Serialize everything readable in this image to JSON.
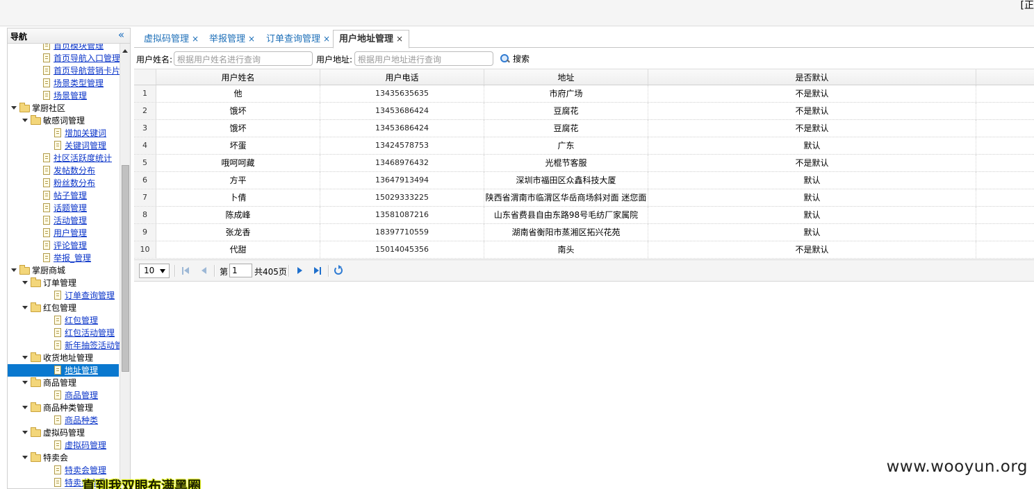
{
  "header": {
    "corner_text": "[正"
  },
  "nav": {
    "title": "导航",
    "tree": [
      {
        "label": "首页模块管理",
        "type": "file",
        "level": 2,
        "link": true
      },
      {
        "label": "首页导航入口管理",
        "type": "file",
        "level": 2,
        "link": true
      },
      {
        "label": "首页导航营销卡片管",
        "type": "file",
        "level": 2,
        "link": true
      },
      {
        "label": "场景类型管理",
        "type": "file",
        "level": 2,
        "link": true
      },
      {
        "label": "场景管理",
        "type": "file",
        "level": 2,
        "link": true
      },
      {
        "label": "掌厨社区",
        "type": "folder",
        "level": 1
      },
      {
        "label": "敏感词管理",
        "type": "folder",
        "level": 2
      },
      {
        "label": "增加关键词",
        "type": "file",
        "level": 3,
        "link": true
      },
      {
        "label": "关键词管理",
        "type": "file",
        "level": 3,
        "link": true
      },
      {
        "label": "社区活跃度统计",
        "type": "file",
        "level": 2,
        "link": true
      },
      {
        "label": "发帖数分布",
        "type": "file",
        "level": 2,
        "link": true
      },
      {
        "label": "粉丝数分布",
        "type": "file",
        "level": 2,
        "link": true
      },
      {
        "label": "帖子管理",
        "type": "file",
        "level": 2,
        "link": true
      },
      {
        "label": "话题管理",
        "type": "file",
        "level": 2,
        "link": true
      },
      {
        "label": "活动管理",
        "type": "file",
        "level": 2,
        "link": true
      },
      {
        "label": "用户管理",
        "type": "file",
        "level": 2,
        "link": true
      },
      {
        "label": "评论管理",
        "type": "file",
        "level": 2,
        "link": true
      },
      {
        "label": "举报_管理",
        "type": "file",
        "level": 2,
        "link": true
      },
      {
        "label": "掌厨商城",
        "type": "folder",
        "level": 1
      },
      {
        "label": "订单管理",
        "type": "folder",
        "level": 2
      },
      {
        "label": "订单查询管理",
        "type": "file",
        "level": 3,
        "link": true
      },
      {
        "label": "红包管理",
        "type": "folder",
        "level": 2
      },
      {
        "label": "红包管理",
        "type": "file",
        "level": 3,
        "link": true
      },
      {
        "label": "红包活动管理",
        "type": "file",
        "level": 3,
        "link": true
      },
      {
        "label": "新年抽签活动管理",
        "type": "file",
        "level": 3,
        "link": true
      },
      {
        "label": "收货地址管理",
        "type": "folder",
        "level": 2
      },
      {
        "label": "地址管理",
        "type": "file",
        "level": 3,
        "link": true,
        "selected": true
      },
      {
        "label": "商品管理",
        "type": "folder",
        "level": 2
      },
      {
        "label": "商品管理",
        "type": "file",
        "level": 3,
        "link": true
      },
      {
        "label": "商品种类管理",
        "type": "folder",
        "level": 2
      },
      {
        "label": "商品种类",
        "type": "file",
        "level": 3,
        "link": true
      },
      {
        "label": "虚拟码管理",
        "type": "folder",
        "level": 2
      },
      {
        "label": "虚拟码管理",
        "type": "file",
        "level": 3,
        "link": true
      },
      {
        "label": "特卖会",
        "type": "folder",
        "level": 2
      },
      {
        "label": "特卖会管理",
        "type": "file",
        "level": 3,
        "link": true
      },
      {
        "label": "特卖会商品",
        "type": "file",
        "level": 3,
        "link": true
      }
    ]
  },
  "tabs": [
    {
      "label": "虚拟码管理",
      "active": false
    },
    {
      "label": "举报管理",
      "active": false
    },
    {
      "label": "订单查询管理",
      "active": false
    },
    {
      "label": "用户地址管理",
      "active": true
    }
  ],
  "tab_close_glyph": "×",
  "search": {
    "name_label": "用户姓名:",
    "name_placeholder": "根据用户姓名进行查询",
    "address_label": "用户地址:",
    "address_placeholder": "根据用户地址进行查询",
    "button_label": "搜索"
  },
  "grid": {
    "columns": [
      "用户姓名",
      "用户电话",
      "地址",
      "是否默认"
    ],
    "rows": [
      {
        "num": "1",
        "name": "他",
        "phone": "13435635635",
        "address": "市府广场",
        "default": "不是默认"
      },
      {
        "num": "2",
        "name": "饿坏",
        "phone": "13453686424",
        "address": "豆腐花",
        "default": "不是默认"
      },
      {
        "num": "3",
        "name": "饿坏",
        "phone": "13453686424",
        "address": "豆腐花",
        "default": "不是默认"
      },
      {
        "num": "4",
        "name": "坏蛋",
        "phone": "13424578753",
        "address": "广东",
        "default": "默认"
      },
      {
        "num": "5",
        "name": "哦呵呵藏",
        "phone": "13468976432",
        "address": "光棍节客服",
        "default": "不是默认"
      },
      {
        "num": "6",
        "name": "方平",
        "phone": "13647913494",
        "address": "深圳市福田区众鑫科技大厦",
        "default": "默认"
      },
      {
        "num": "7",
        "name": "卜倩",
        "phone": "15029333225",
        "address": "陕西省渭南市临渭区华岳商场斜对面 迷您面",
        "default": "默认"
      },
      {
        "num": "8",
        "name": "陈成峰",
        "phone": "13581087216",
        "address": "山东省费县自由东路98号毛纺厂家属院",
        "default": "默认"
      },
      {
        "num": "9",
        "name": "张龙香",
        "phone": "18397710559",
        "address": "湖南省衡阳市蒸湘区拓兴花苑",
        "default": "默认"
      },
      {
        "num": "10",
        "name": "代甜",
        "phone": "15014045356",
        "address": "南头",
        "default": "不是默认"
      }
    ]
  },
  "pager": {
    "page_size": "10",
    "page_prefix": "第",
    "current_page": "1",
    "total_text": "共405页"
  },
  "watermark": "www.wooyun.org",
  "overlay_text": "直到我双眼布满黑圈"
}
